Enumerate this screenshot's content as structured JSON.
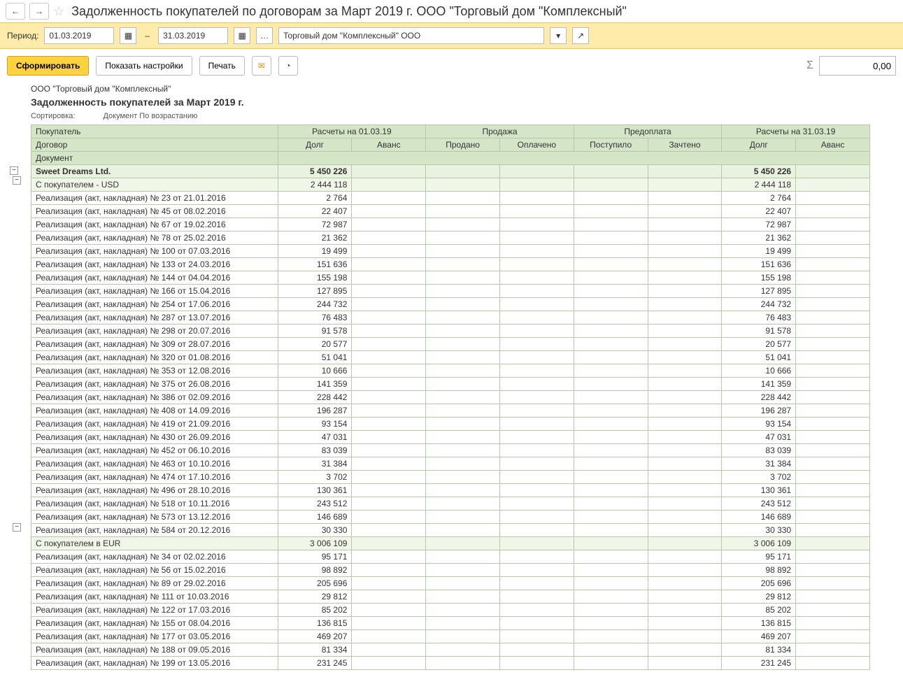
{
  "titlebar": {
    "title": "Задолженность покупателей по договорам за Март 2019 г. ООО \"Торговый дом \"Комплексный\""
  },
  "filter": {
    "period_label": "Период:",
    "date_from": "01.03.2019",
    "date_to": "31.03.2019",
    "organization": "Торговый дом \"Комплексный\" ООО"
  },
  "actions": {
    "form": "Сформировать",
    "show_settings": "Показать настройки",
    "print": "Печать",
    "sum_value": "0,00"
  },
  "report_header": {
    "company": "ООО \"Торговый дом \"Комплексный\"",
    "title": "Задолженность покупателей за Март 2019 г.",
    "sort_label": "Сортировка:",
    "sort_value": "Документ По возрастанию"
  },
  "columns": {
    "buyer": "Покупатель",
    "contract": "Договор",
    "document": "Документ",
    "grp_start": "Расчеты на 01.03.19",
    "grp_sale": "Продажа",
    "grp_prepay": "Предоплата",
    "grp_end": "Расчеты на 31.03.19",
    "debt": "Долг",
    "advance": "Аванс",
    "sold": "Продано",
    "paid": "Оплачено",
    "received": "Поступило",
    "credited": "Зачтено"
  },
  "rows": [
    {
      "level": 0,
      "name": "Sweet Dreams Ltd.",
      "debt1": "5 450 226",
      "debt2": "5 450 226"
    },
    {
      "level": 1,
      "name": "С покупателем - USD",
      "debt1": "2 444 118",
      "debt2": "2 444 118"
    },
    {
      "level": 2,
      "name": "Реализация (акт, накладная) № 23 от 21.01.2016",
      "debt1": "2 764",
      "debt2": "2 764"
    },
    {
      "level": 2,
      "name": "Реализация (акт, накладная) № 45 от 08.02.2016",
      "debt1": "22 407",
      "debt2": "22 407"
    },
    {
      "level": 2,
      "name": "Реализация (акт, накладная) № 67 от 19.02.2016",
      "debt1": "72 987",
      "debt2": "72 987"
    },
    {
      "level": 2,
      "name": "Реализация (акт, накладная) № 78 от 25.02.2016",
      "debt1": "21 362",
      "debt2": "21 362"
    },
    {
      "level": 2,
      "name": "Реализация (акт, накладная) № 100 от 07.03.2016",
      "debt1": "19 499",
      "debt2": "19 499"
    },
    {
      "level": 2,
      "name": "Реализация (акт, накладная) № 133 от 24.03.2016",
      "debt1": "151 636",
      "debt2": "151 636"
    },
    {
      "level": 2,
      "name": "Реализация (акт, накладная) № 144 от 04.04.2016",
      "debt1": "155 198",
      "debt2": "155 198"
    },
    {
      "level": 2,
      "name": "Реализация (акт, накладная) № 166 от 15.04.2016",
      "debt1": "127 895",
      "debt2": "127 895"
    },
    {
      "level": 2,
      "name": "Реализация (акт, накладная) № 254 от 17.06.2016",
      "debt1": "244 732",
      "debt2": "244 732"
    },
    {
      "level": 2,
      "name": "Реализация (акт, накладная) № 287 от 13.07.2016",
      "debt1": "76 483",
      "debt2": "76 483"
    },
    {
      "level": 2,
      "name": "Реализация (акт, накладная) № 298 от 20.07.2016",
      "debt1": "91 578",
      "debt2": "91 578"
    },
    {
      "level": 2,
      "name": "Реализация (акт, накладная) № 309 от 28.07.2016",
      "debt1": "20 577",
      "debt2": "20 577"
    },
    {
      "level": 2,
      "name": "Реализация (акт, накладная) № 320 от 01.08.2016",
      "debt1": "51 041",
      "debt2": "51 041"
    },
    {
      "level": 2,
      "name": "Реализация (акт, накладная) № 353 от 12.08.2016",
      "debt1": "10 666",
      "debt2": "10 666"
    },
    {
      "level": 2,
      "name": "Реализация (акт, накладная) № 375 от 26.08.2016",
      "debt1": "141 359",
      "debt2": "141 359"
    },
    {
      "level": 2,
      "name": "Реализация (акт, накладная) № 386 от 02.09.2016",
      "debt1": "228 442",
      "debt2": "228 442"
    },
    {
      "level": 2,
      "name": "Реализация (акт, накладная) № 408 от 14.09.2016",
      "debt1": "196 287",
      "debt2": "196 287"
    },
    {
      "level": 2,
      "name": "Реализация (акт, накладная) № 419 от 21.09.2016",
      "debt1": "93 154",
      "debt2": "93 154"
    },
    {
      "level": 2,
      "name": "Реализация (акт, накладная) № 430 от 26.09.2016",
      "debt1": "47 031",
      "debt2": "47 031"
    },
    {
      "level": 2,
      "name": "Реализация (акт, накладная) № 452 от 06.10.2016",
      "debt1": "83 039",
      "debt2": "83 039"
    },
    {
      "level": 2,
      "name": "Реализация (акт, накладная) № 463 от 10.10.2016",
      "debt1": "31 384",
      "debt2": "31 384"
    },
    {
      "level": 2,
      "name": "Реализация (акт, накладная) № 474 от 17.10.2016",
      "debt1": "3 702",
      "debt2": "3 702"
    },
    {
      "level": 2,
      "name": "Реализация (акт, накладная) № 496 от 28.10.2016",
      "debt1": "130 361",
      "debt2": "130 361"
    },
    {
      "level": 2,
      "name": "Реализация (акт, накладная) № 518 от 10.11.2016",
      "debt1": "243 512",
      "debt2": "243 512"
    },
    {
      "level": 2,
      "name": "Реализация (акт, накладная) № 573 от 13.12.2016",
      "debt1": "146 689",
      "debt2": "146 689"
    },
    {
      "level": 2,
      "name": "Реализация (акт, накладная) № 584 от 20.12.2016",
      "debt1": "30 330",
      "debt2": "30 330"
    },
    {
      "level": 1,
      "name": "С покупателем в EUR",
      "debt1": "3 006 109",
      "debt2": "3 006 109"
    },
    {
      "level": 2,
      "name": "Реализация (акт, накладная) № 34 от 02.02.2016",
      "debt1": "95 171",
      "debt2": "95 171"
    },
    {
      "level": 2,
      "name": "Реализация (акт, накладная) № 56 от 15.02.2016",
      "debt1": "98 892",
      "debt2": "98 892"
    },
    {
      "level": 2,
      "name": "Реализация (акт, накладная) № 89 от 29.02.2016",
      "debt1": "205 696",
      "debt2": "205 696"
    },
    {
      "level": 2,
      "name": "Реализация (акт, накладная) № 111 от 10.03.2016",
      "debt1": "29 812",
      "debt2": "29 812"
    },
    {
      "level": 2,
      "name": "Реализация (акт, накладная) № 122 от 17.03.2016",
      "debt1": "85 202",
      "debt2": "85 202"
    },
    {
      "level": 2,
      "name": "Реализация (акт, накладная) № 155 от 08.04.2016",
      "debt1": "136 815",
      "debt2": "136 815"
    },
    {
      "level": 2,
      "name": "Реализация (акт, накладная) № 177 от 03.05.2016",
      "debt1": "469 207",
      "debt2": "469 207"
    },
    {
      "level": 2,
      "name": "Реализация (акт, накладная) № 188 от 09.05.2016",
      "debt1": "81 334",
      "debt2": "81 334"
    },
    {
      "level": 2,
      "name": "Реализация (акт, накладная) № 199 от 13.05.2016",
      "debt1": "231 245",
      "debt2": "231 245"
    }
  ]
}
